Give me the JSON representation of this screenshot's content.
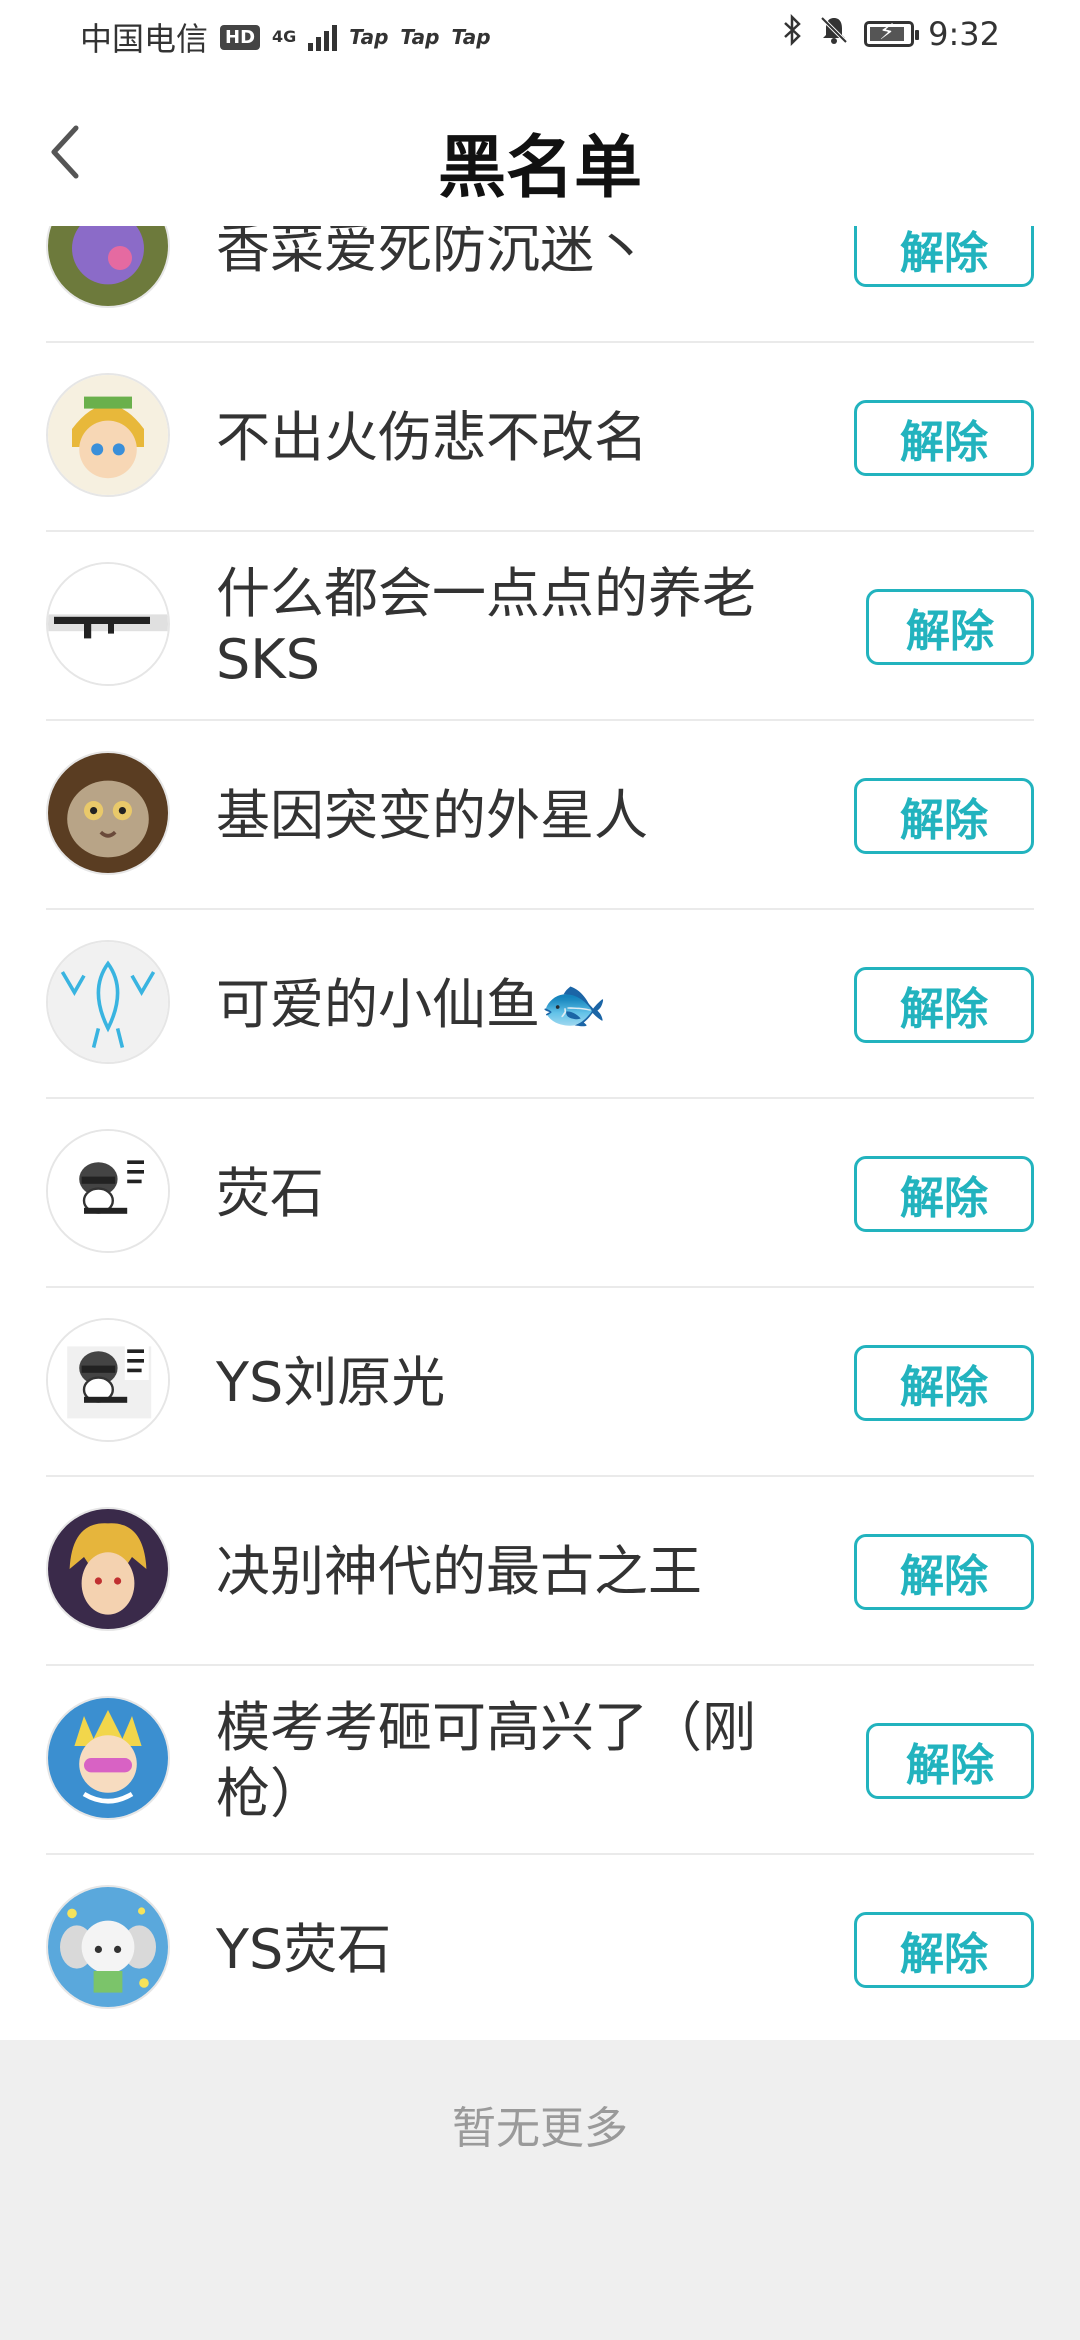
{
  "status_bar": {
    "carrier": "中国电信",
    "hd": "HD",
    "network": "4G",
    "tap_icons": [
      "Tap",
      "Tap",
      "Tap"
    ],
    "time": "9:32",
    "icons": [
      "bluetooth-icon",
      "mute-icon",
      "battery-icon"
    ]
  },
  "header": {
    "title": "黑名单",
    "back_icon": "chevron-left-icon"
  },
  "list": {
    "items": [
      {
        "name": "香菜爱死防沉迷丶",
        "button": "解除"
      },
      {
        "name": "不出火伤悲不改名",
        "button": "解除"
      },
      {
        "name": "什么都会一点点的养老SKS",
        "button": "解除"
      },
      {
        "name": "基因突变的外星人",
        "button": "解除"
      },
      {
        "name": "可爱的小仙鱼🐟",
        "button": "解除"
      },
      {
        "name": "荧石",
        "button": "解除"
      },
      {
        "name": "YS刘原光",
        "button": "解除"
      },
      {
        "name": "决别神代的最古之王",
        "button": "解除"
      },
      {
        "name": "模考考砸可高兴了（刚枪）",
        "button": "解除"
      },
      {
        "name": "YS荧石",
        "button": "解除"
      }
    ]
  },
  "footer": {
    "text": "暂无更多"
  },
  "colors": {
    "accent": "#22b3be",
    "footer_bg": "#efefef"
  }
}
